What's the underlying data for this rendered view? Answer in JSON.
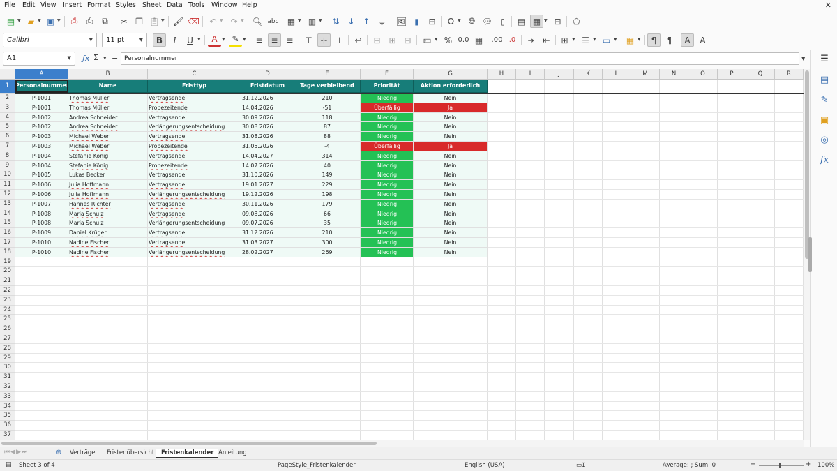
{
  "menu": [
    "File",
    "Edit",
    "View",
    "Insert",
    "Format",
    "Styles",
    "Sheet",
    "Data",
    "Tools",
    "Window",
    "Help"
  ],
  "font": {
    "name": "Calibri",
    "size": "11 pt"
  },
  "formula_bar": {
    "name_box": "A1",
    "content": "Personalnummer",
    "fx_icon": "ƒx",
    "sum_icon": "Σ",
    "equals": "="
  },
  "columns": [
    "A",
    "B",
    "C",
    "D",
    "E",
    "F",
    "G",
    "H",
    "I",
    "J",
    "K",
    "L",
    "M",
    "N",
    "O",
    "P",
    "Q",
    "R"
  ],
  "header": [
    "Personalnummer",
    "Name",
    "Fristtyp",
    "Fristdatum",
    "Tage verbleibend",
    "Priorität",
    "Aktion erforderlich"
  ],
  "rows": [
    [
      "P-1001",
      "Thomas Müller",
      "Vertragsende",
      "31.12.2026",
      "210",
      "Niedrig",
      "Nein"
    ],
    [
      "P-1001",
      "Thomas Müller",
      "Probezeitende",
      "14.04.2026",
      "-51",
      "Überfällig",
      "Ja"
    ],
    [
      "P-1002",
      "Andrea Schneider",
      "Vertragsende",
      "30.09.2026",
      "118",
      "Niedrig",
      "Nein"
    ],
    [
      "P-1002",
      "Andrea Schneider",
      "Verlängerungsentscheidung",
      "30.08.2026",
      "87",
      "Niedrig",
      "Nein"
    ],
    [
      "P-1003",
      "Michael Weber",
      "Vertragsende",
      "31.08.2026",
      "88",
      "Niedrig",
      "Nein"
    ],
    [
      "P-1003",
      "Michael Weber",
      "Probezeitende",
      "31.05.2026",
      "-4",
      "Überfällig",
      "Ja"
    ],
    [
      "P-1004",
      "Stefanie König",
      "Vertragsende",
      "14.04.2027",
      "314",
      "Niedrig",
      "Nein"
    ],
    [
      "P-1004",
      "Stefanie König",
      "Probezeitende",
      "14.07.2026",
      "40",
      "Niedrig",
      "Nein"
    ],
    [
      "P-1005",
      "Lukas Becker",
      "Vertragsende",
      "31.10.2026",
      "149",
      "Niedrig",
      "Nein"
    ],
    [
      "P-1006",
      "Julia Hoffmann",
      "Vertragsende",
      "19.01.2027",
      "229",
      "Niedrig",
      "Nein"
    ],
    [
      "P-1006",
      "Julia Hoffmann",
      "Verlängerungsentscheidung",
      "19.12.2026",
      "198",
      "Niedrig",
      "Nein"
    ],
    [
      "P-1007",
      "Hannes Richter",
      "Vertragsende",
      "30.11.2026",
      "179",
      "Niedrig",
      "Nein"
    ],
    [
      "P-1008",
      "Maria Schulz",
      "Vertragsende",
      "09.08.2026",
      "66",
      "Niedrig",
      "Nein"
    ],
    [
      "P-1008",
      "Maria Schulz",
      "Verlängerungsentscheidung",
      "09.07.2026",
      "35",
      "Niedrig",
      "Nein"
    ],
    [
      "P-1009",
      "Daniel Krüger",
      "Vertragsende",
      "31.12.2026",
      "210",
      "Niedrig",
      "Nein"
    ],
    [
      "P-1010",
      "Nadine Fischer",
      "Vertragsende",
      "31.03.2027",
      "300",
      "Niedrig",
      "Nein"
    ],
    [
      "P-1010",
      "Nadine Fischer",
      "Verlängerungsentscheidung",
      "28.02.2027",
      "269",
      "Niedrig",
      "Nein"
    ]
  ],
  "tabs": [
    "Verträge",
    "Fristenübersicht",
    "Fristenkalender",
    "Anleitung"
  ],
  "active_tab": "Fristenkalender",
  "status": {
    "sheet": "Sheet 3 of 4",
    "page_style": "PageStyle_Fristenkalender",
    "language": "English (USA)",
    "sum": "Average: ; Sum: 0",
    "zoom": "100%"
  },
  "colors": {
    "header_teal": "#177d79",
    "low_green": "#24c155",
    "overdue_red": "#d82a2a",
    "row_tint": "#effaf6",
    "selection_blue": "#3b7fcc"
  }
}
